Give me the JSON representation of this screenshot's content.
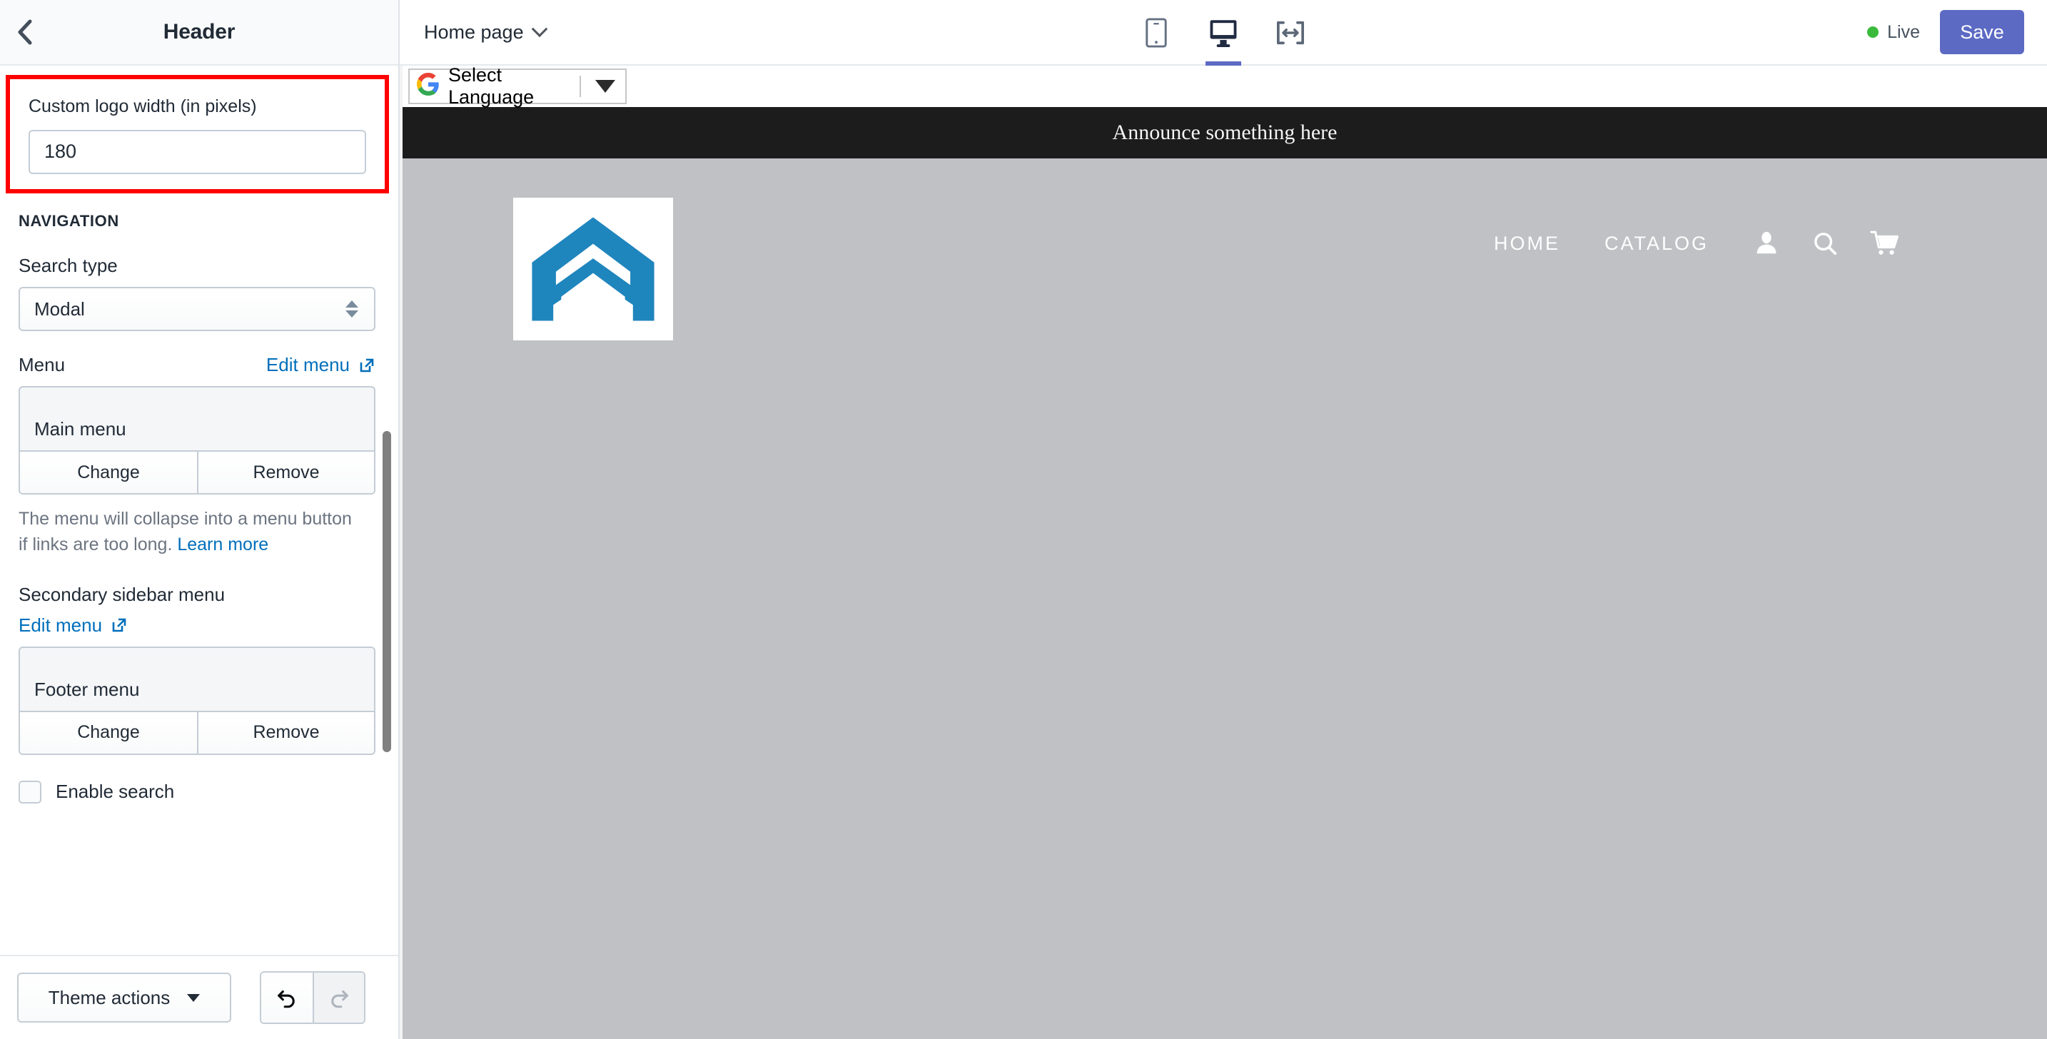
{
  "sidebar": {
    "back_icon": "chevron-left-icon",
    "title": "Header",
    "logo_width_field": {
      "label": "Custom logo width (in pixels)",
      "value": "180"
    },
    "navigation_section": {
      "heading": "NAVIGATION",
      "search_type": {
        "label": "Search type",
        "value": "Modal"
      },
      "menu": {
        "label": "Menu",
        "edit_link": "Edit menu",
        "edit_link_icon": "external-link-icon",
        "selected": "Main menu",
        "change_label": "Change",
        "remove_label": "Remove",
        "help_text": "The menu will collapse into a menu button if links are too long. ",
        "help_link": "Learn more"
      },
      "secondary_menu": {
        "label": "Secondary sidebar menu",
        "edit_link": "Edit menu",
        "edit_link_icon": "external-link-icon",
        "selected": "Footer menu",
        "change_label": "Change",
        "remove_label": "Remove"
      },
      "enable_search": {
        "label": "Enable search",
        "checked": false
      }
    },
    "footer": {
      "theme_actions_label": "Theme actions",
      "undo_icon": "undo-icon",
      "redo_icon": "redo-icon"
    }
  },
  "topbar": {
    "page_selector": "Home page",
    "page_selector_icon": "chevron-down-icon",
    "devices": [
      {
        "name": "mobile-view",
        "icon": "mobile-icon",
        "active": false
      },
      {
        "name": "desktop-view",
        "icon": "desktop-icon",
        "active": true
      },
      {
        "name": "fullwidth-view",
        "icon": "fullwidth-icon",
        "active": false
      }
    ],
    "live_label": "Live",
    "live_color": "#3aba3a",
    "save_label": "Save",
    "save_color": "#5c6ac4"
  },
  "preview": {
    "google_translate": {
      "icon": "google-g-icon",
      "label": "Select Language",
      "caret_icon": "caret-down-icon"
    },
    "announcement": "Announce something here",
    "logo": {
      "icon": "chevron-logo-icon",
      "color": "#1f85bd",
      "background": "#ffffff"
    },
    "nav_links": [
      "HOME",
      "CATALOG"
    ],
    "nav_icons": [
      {
        "name": "account-icon",
        "glyph": "person"
      },
      {
        "name": "search-icon",
        "glyph": "magnifier"
      },
      {
        "name": "cart-icon",
        "glyph": "cart"
      }
    ],
    "background": "#bfc1c4",
    "announcement_bg": "#1c1c1c"
  }
}
